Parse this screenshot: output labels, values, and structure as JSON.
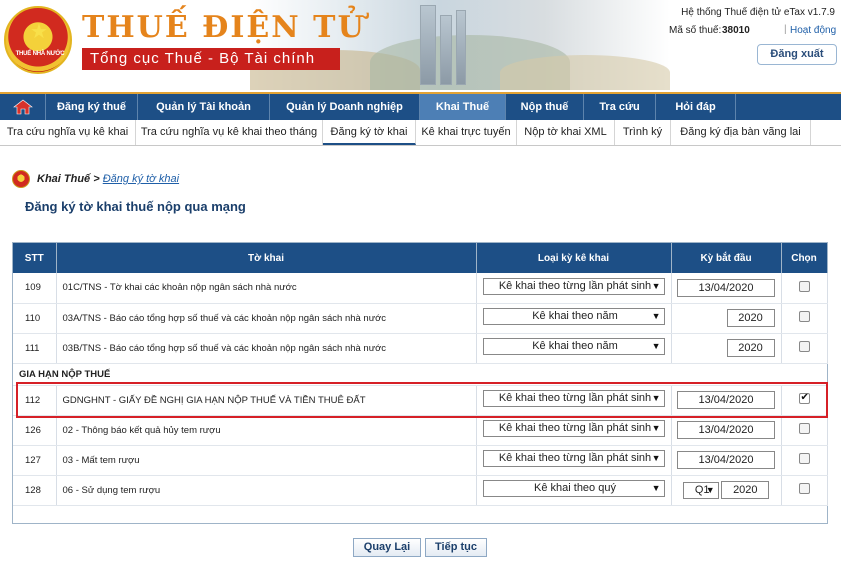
{
  "header": {
    "emblem_text": "THUẾ NHÀ NƯỚC",
    "brand_title": "THUẾ ĐIỆN TỬ",
    "brand_sub": "Tổng cục Thuế - Bộ Tài chính",
    "system_name": "Hệ thống Thuế điện tử eTax v1.7.9",
    "taxcode_label": "Mã số thuế:",
    "taxcode_value": "38010",
    "taxcode_sep": "|",
    "active_link": "Hoạt động",
    "logout": "Đăng xuất"
  },
  "mainnav": {
    "items": [
      "Đăng ký thuế",
      "Quản lý Tài khoản",
      "Quản lý Doanh nghiệp",
      "Khai Thuế",
      "Nộp thuế",
      "Tra cứu",
      "Hỏi đáp"
    ],
    "active": "Khai Thuế"
  },
  "subnav": {
    "items": [
      "Tra cứu nghĩa vụ kê khai",
      "Tra cứu nghĩa vụ kê khai theo tháng",
      "Đăng ký tờ khai",
      "Kê khai trực tuyến",
      "Nộp tờ khai XML",
      "Trình ký",
      "Đăng ký địa bàn vãng lai"
    ],
    "active": "Đăng ký tờ khai"
  },
  "breadcrumb": {
    "first": "Khai Thuế",
    "sep": " > ",
    "current": "Đăng ký tờ khai"
  },
  "page_title": "Đăng ký tờ khai thuế nộp qua mạng",
  "table": {
    "headers": {
      "stt": "STT",
      "tokhai": "Tờ khai",
      "loai": "Loại kỳ kê khai",
      "ky": "Kỳ bắt đầu",
      "chon": "Chọn"
    },
    "rows": [
      {
        "stt": "109",
        "name": "01C/TNS - Tờ khai các khoản nộp ngân sách nhà nước",
        "loai": "Kê khai theo từng lần phát sinh",
        "date": "13/04/2020",
        "year": "",
        "quarter": "",
        "checked": false
      },
      {
        "stt": "110",
        "name": "03A/TNS - Báo cáo tổng hợp số thuế và các khoản nộp ngân sách nhà nước",
        "loai": "Kê khai theo năm",
        "date": "",
        "year": "2020",
        "quarter": "",
        "checked": false
      },
      {
        "stt": "111",
        "name": "03B/TNS - Báo cáo tổng hợp số thuế và các khoản nộp ngân sách nhà nước",
        "loai": "Kê khai theo năm",
        "date": "",
        "year": "2020",
        "quarter": "",
        "checked": false
      }
    ],
    "group_label": "GIA HẠN NỘP THUẾ",
    "rows2": [
      {
        "stt": "112",
        "name": "GDNGHNT - GIẤY ĐỀ NGHỊ GIA HẠN NỘP THUẾ VÀ TIỀN THUÊ ĐẤT",
        "loai": "Kê khai theo từng lần phát sinh",
        "date": "13/04/2020",
        "checked": true
      },
      {
        "stt": "126",
        "name": "02 - Thông báo kết quả hủy tem rượu",
        "loai": "Kê khai theo từng lần phát sinh",
        "date": "13/04/2020",
        "checked": false
      },
      {
        "stt": "127",
        "name": "03 - Mất tem rượu",
        "loai": "Kê khai theo từng lần phát sinh",
        "date": "13/04/2020",
        "checked": false
      },
      {
        "stt": "128",
        "name": "06 - Sử dụng tem rượu",
        "loai": "Kê khai theo quý",
        "quarter": "Q1",
        "year": "2020",
        "checked": false
      }
    ]
  },
  "buttons": {
    "back": "Quay Lại",
    "next": "Tiếp tục"
  },
  "colors": {
    "nav_bg": "#1d4f86",
    "highlight": "#d62027",
    "brand_orange": "#e5841c",
    "brand_red": "#c8201c"
  }
}
